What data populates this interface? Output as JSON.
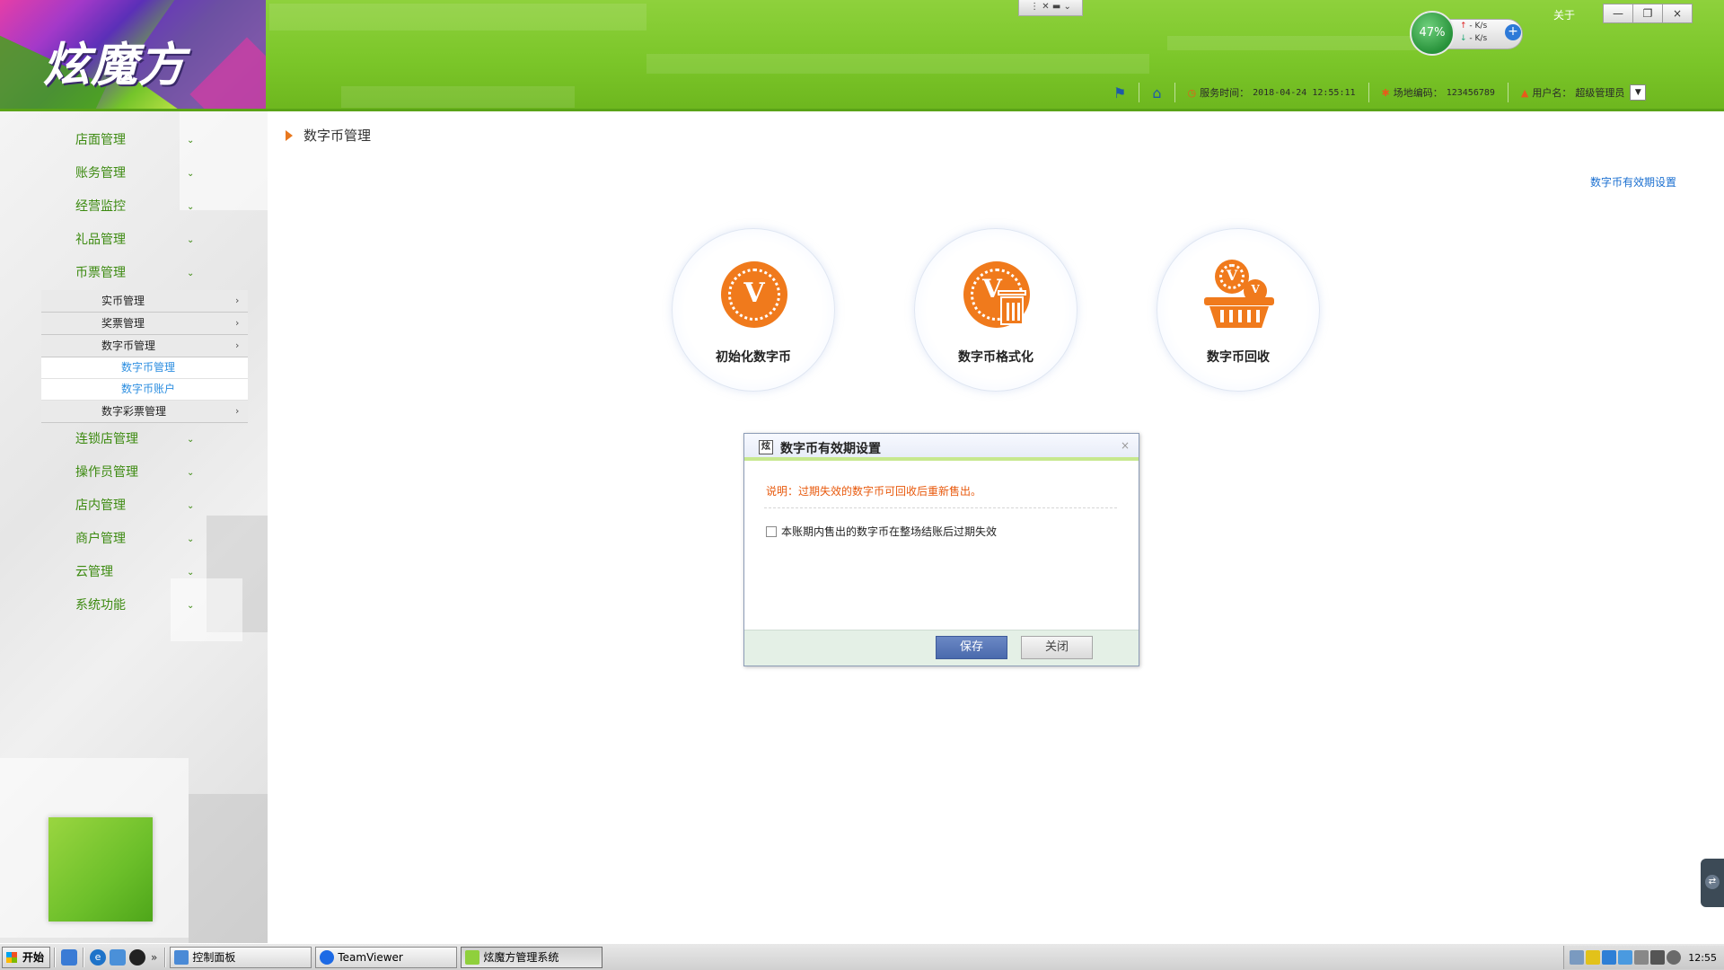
{
  "header": {
    "logo_text": "炫魔方",
    "about": "关于",
    "window_buttons": {
      "minimize": "—",
      "restore": "❐",
      "close": "×"
    },
    "collapse_tab": "⋮ ✕ ▬ ⌄",
    "network": {
      "percent": "47%",
      "up": "- K/s",
      "down": "- K/s",
      "add": "+"
    },
    "info": {
      "service_time_label": "服务时间：",
      "service_time_value": "2018-04-24 12:55:11",
      "venue_code_label": "场地编码：",
      "venue_code_value": "123456789",
      "username_label": "用户名：",
      "username_value": "超级管理员"
    }
  },
  "sidebar": {
    "menu_top": [
      {
        "label": "店面管理"
      },
      {
        "label": "账务管理"
      },
      {
        "label": "经营监控"
      },
      {
        "label": "礼品管理"
      },
      {
        "label": "币票管理"
      }
    ],
    "sub": [
      {
        "label": "实币管理"
      },
      {
        "label": "奖票管理"
      },
      {
        "label": "数字币管理"
      }
    ],
    "subsub": [
      {
        "label": "数字币管理"
      },
      {
        "label": "数字币账户"
      }
    ],
    "sub_after": [
      {
        "label": "数字彩票管理"
      }
    ],
    "menu_bottom": [
      {
        "label": "连锁店管理"
      },
      {
        "label": "操作员管理"
      },
      {
        "label": "店内管理"
      },
      {
        "label": "商户管理"
      },
      {
        "label": "云管理"
      },
      {
        "label": "系统功能"
      }
    ]
  },
  "main": {
    "breadcrumb": "数字币管理",
    "expiry_link": "数字币有效期设置",
    "actions": [
      {
        "label": "初始化数字币",
        "icon": "coin-icon"
      },
      {
        "label": "数字币格式化",
        "icon": "coin-trash-icon"
      },
      {
        "label": "数字币回收",
        "icon": "coin-basket-icon"
      }
    ]
  },
  "dialog": {
    "title_icon": "炫",
    "title": "数字币有效期设置",
    "close": "×",
    "note": "说明：过期失效的数字币可回收后重新售出。",
    "checkbox_label": "本账期内售出的数字币在整场结账后过期失效",
    "checkbox_checked": false,
    "save": "保存",
    "cancel": "关闭"
  },
  "taskbar": {
    "start": "开始",
    "more": "»",
    "tasks": [
      {
        "label": "控制面板"
      },
      {
        "label": "TeamViewer"
      },
      {
        "label": "炫魔方管理系统"
      }
    ],
    "clock": "12:55"
  },
  "colors": {
    "header_green": "#7bc629",
    "menu_green": "#3c8a10",
    "accent_orange": "#f07a1c",
    "link_blue": "#1a6fd0",
    "save_blue": "#4a6aad"
  }
}
